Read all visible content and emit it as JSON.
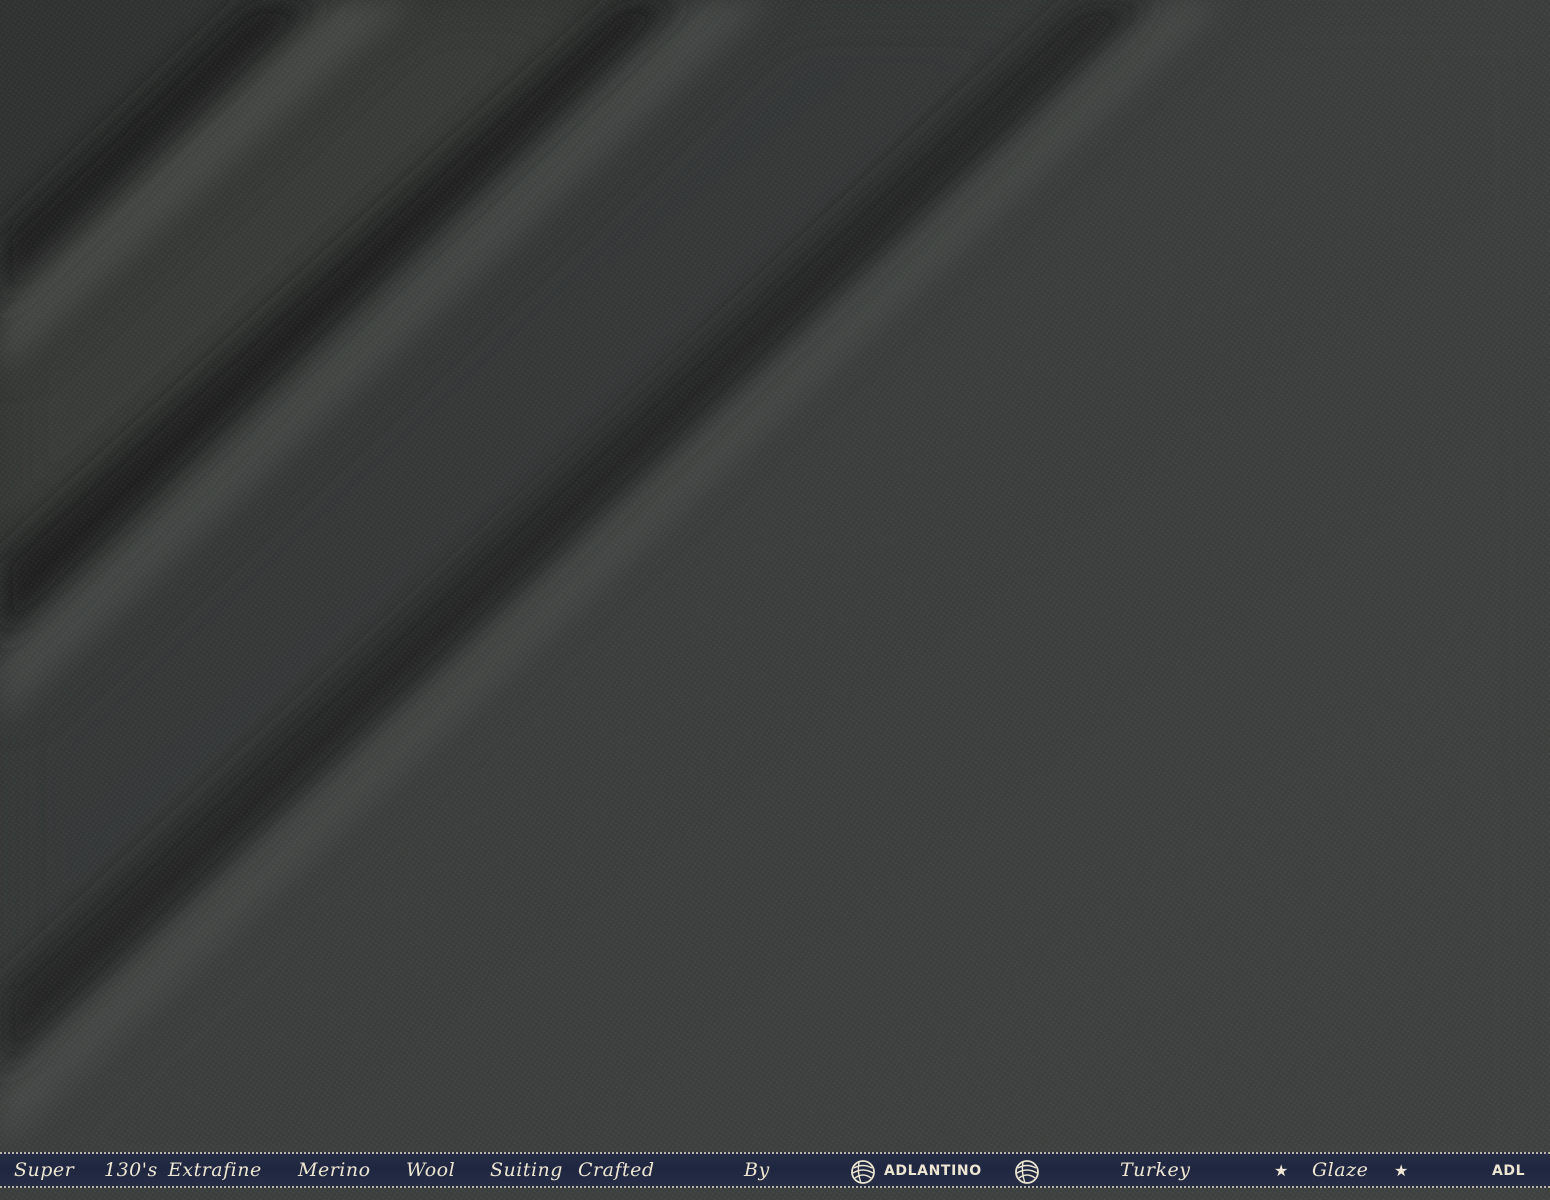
{
  "selvedge": {
    "words": {
      "w1": "Super",
      "w2": "130's",
      "w3": "Extrafine",
      "w4": "Merino",
      "w5": "Wool",
      "w6": "Suiting",
      "w7": "Crafted",
      "w8": "By",
      "brand": "ADLANTINO",
      "w9": "Turkey",
      "w10": "Glaze",
      "w11": "ADL"
    },
    "icons": [
      "yarn-ball-icon",
      "yarn-ball-icon",
      "star-icon",
      "star-icon"
    ]
  },
  "colors": {
    "fabric": "#3d403e",
    "fabric_highlight": "#565a57",
    "fabric_shadow": "#232624",
    "selvedge_band": "#232a43",
    "selvedge_text": "#ece6d2"
  }
}
